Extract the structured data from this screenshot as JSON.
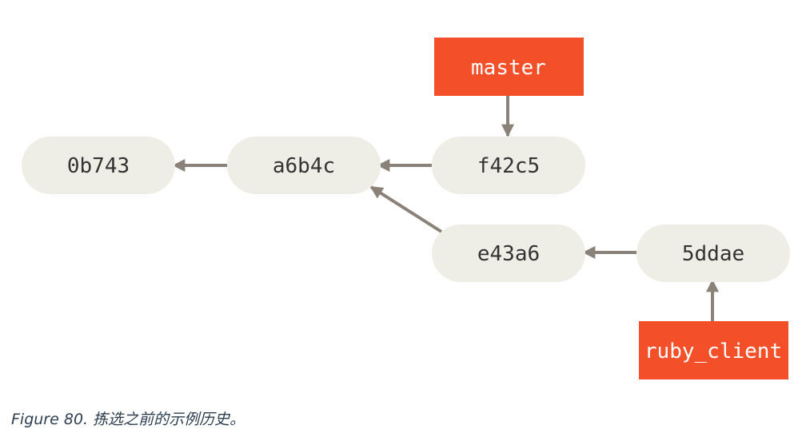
{
  "diagram": {
    "commits": {
      "c0b743": "0b743",
      "ca6b4c": "a6b4c",
      "cf42c5": "f42c5",
      "ce43a6": "e43a6",
      "c5ddae": "5ddae"
    },
    "branches": {
      "master": "master",
      "ruby_client": "ruby_client"
    },
    "colors": {
      "commit_fill": "#eeede6",
      "branch_fill": "#f34f29",
      "arrow": "#8a8178"
    }
  },
  "caption": {
    "label": "Figure 80.",
    "text": "拣选之前的示例历史。"
  }
}
